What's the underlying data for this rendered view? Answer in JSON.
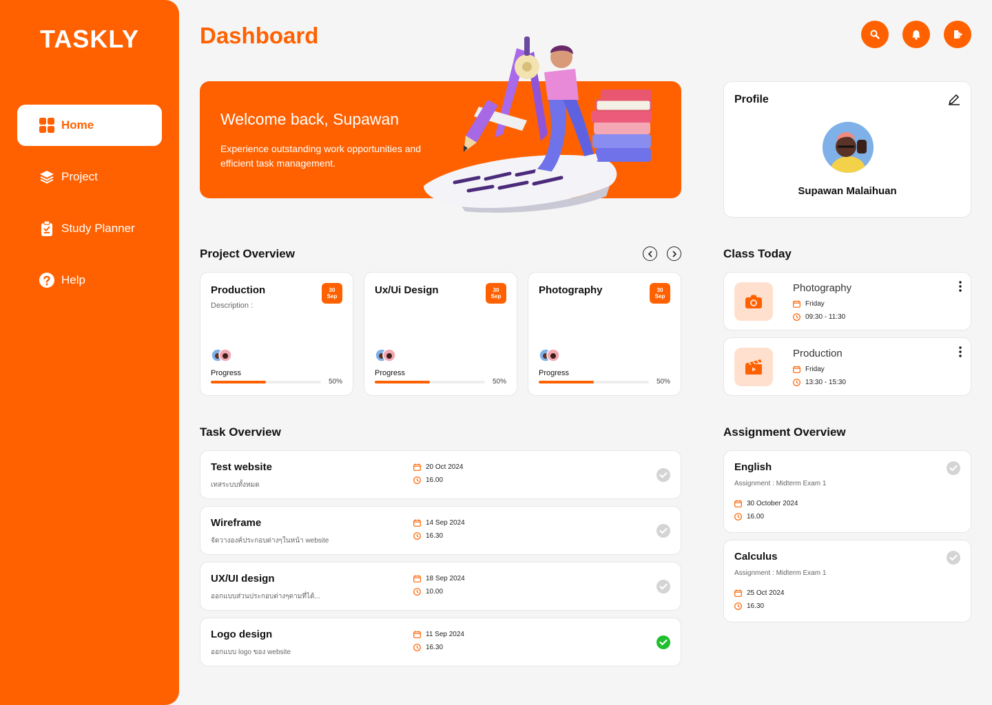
{
  "app": {
    "logo": "TASKLY",
    "page_title": "Dashboard"
  },
  "colors": {
    "accent": "#ff6100",
    "accent_light": "#ffe0cf",
    "done_green": "#1fbf2f",
    "pending_grey": "#d4d4d4"
  },
  "sidebar": {
    "items": [
      {
        "label": "Home",
        "icon": "grid-icon",
        "active": true
      },
      {
        "label": "Project",
        "icon": "layers-icon",
        "active": false
      },
      {
        "label": "Study Planner",
        "icon": "clipboard-icon",
        "active": false
      },
      {
        "label": "Help",
        "icon": "question-icon",
        "active": false
      }
    ]
  },
  "header": {
    "buttons": [
      "search-icon",
      "bell-icon",
      "logout-icon"
    ]
  },
  "banner": {
    "title": "Welcome back, Supawan",
    "subtitle": "Experience outstanding work opportunities and efficient task management."
  },
  "profile": {
    "title": "Profile",
    "name": "Supawan Malaihuan"
  },
  "project_overview": {
    "title": "Project Overview",
    "projects": [
      {
        "title": "Production",
        "description": "Description :",
        "date_day": "30",
        "date_month": "Sep",
        "progress_label": "Progress",
        "progress": 0.5,
        "progress_text": "50%"
      },
      {
        "title": "Ux/Ui Design",
        "description": "",
        "date_day": "30",
        "date_month": "Sep",
        "progress_label": "Progress",
        "progress": 0.5,
        "progress_text": "50%"
      },
      {
        "title": "Photography",
        "description": "",
        "date_day": "30",
        "date_month": "Sep",
        "progress_label": "Progress",
        "progress": 0.5,
        "progress_text": "50%"
      }
    ]
  },
  "class_today": {
    "title": "Class Today",
    "classes": [
      {
        "name": "Photography",
        "icon": "camera-icon",
        "day": "Friday",
        "time": "09:30 - 11:30"
      },
      {
        "name": "Production",
        "icon": "clapperboard-icon",
        "day": "Friday",
        "time": "13:30 - 15:30"
      }
    ]
  },
  "task_overview": {
    "title": "Task Overview",
    "tasks": [
      {
        "title": "Test website",
        "subtitle": "เทสระบบทั้งหมด",
        "date": "20 Oct 2024",
        "time": "16.00",
        "done": false
      },
      {
        "title": "Wireframe",
        "subtitle": "จัดวางองค์ประกอบต่างๆในหน้า website",
        "date": "14 Sep 2024",
        "time": "16.30",
        "done": false
      },
      {
        "title": "UX/UI design",
        "subtitle": "ออกแบบส่วนประกอบต่างๆตามที่ได้...",
        "date": "18 Sep 2024",
        "time": "10.00",
        "done": false
      },
      {
        "title": "Logo design",
        "subtitle": "ออกแบบ logo ของ website",
        "date": "11 Sep 2024",
        "time": "16.30",
        "done": true
      }
    ]
  },
  "assignment_overview": {
    "title": "Assignment Overview",
    "assignments": [
      {
        "title": "English",
        "subtitle": "Assignment : Midterm Exam 1",
        "date": "30 October 2024",
        "time": "16.00",
        "done": false
      },
      {
        "title": "Calculus",
        "subtitle": "Assignment : Midterm Exam 1",
        "date": "25 Oct 2024",
        "time": "16.30",
        "done": false
      }
    ]
  }
}
